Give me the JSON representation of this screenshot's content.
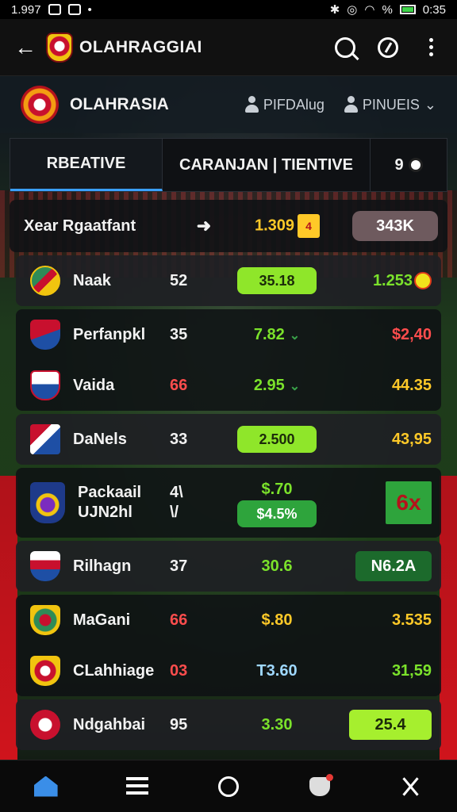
{
  "status": {
    "time_left": "1.997",
    "time_right": "0:35",
    "signal_pct": "%"
  },
  "app_bar": {
    "title": "OLAHRAGGIAI"
  },
  "league": {
    "name": "OLAHRASIA",
    "chip1": "PIFDAlug",
    "chip2": "PINUEIS"
  },
  "tabs": [
    {
      "label": "RBEATIVE"
    },
    {
      "label": "CARANJAN | TIENTIVE"
    },
    {
      "label": "9"
    }
  ],
  "header_row": {
    "label": "Xear Rgaatfant",
    "value": "1.309",
    "flag": "4",
    "total": "343K"
  },
  "rows": [
    {
      "team": "Naak",
      "num": "52",
      "val": "35.18",
      "last": "1.253"
    },
    {
      "team": "Perfanpkl",
      "num": "35",
      "val": "7.82",
      "last": "$2,40"
    },
    {
      "team": "Vaida",
      "num": "66",
      "val": "2.95",
      "last": "44.35"
    },
    {
      "team": "DaNels",
      "num": "33",
      "val": "2.500",
      "last": "43,95"
    },
    {
      "team": "Packaail",
      "team2": "UJN2hl",
      "num": "4\\",
      "num2": "\\/",
      "val": "$.70",
      "val2": "$4.5%",
      "last": "6x"
    },
    {
      "team": "Rilhagn",
      "num": "37",
      "val": "30.6",
      "last": "N6.2A"
    },
    {
      "team": "MaGani",
      "num": "66",
      "val": "$.80",
      "last": "3.535"
    },
    {
      "team": "CLahhiage",
      "num": "03",
      "val": "T3.60",
      "last": "31,59"
    },
    {
      "team": "Ndgahbai",
      "num": "95",
      "val": "3.30",
      "last": "25.4"
    }
  ],
  "colors": {
    "accent": "#3aa0ff",
    "lime": "#8fe62a",
    "yellow": "#ffc928",
    "red": "#ff4d4d"
  }
}
